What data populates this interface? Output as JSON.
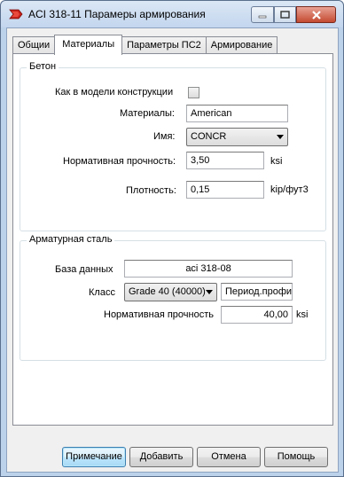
{
  "window": {
    "title": "ACI 318-11 Парамеры армирования"
  },
  "tabs": [
    "Общии",
    "Материалы",
    "Параметры ПС2",
    "Армирование"
  ],
  "concrete": {
    "legend": "Бетон",
    "same_as_model_label": "Как в модели конструкции",
    "same_as_model_checked": false,
    "materials_label": "Материалы:",
    "materials_value": "American",
    "name_label": "Имя:",
    "name_value": "CONCR",
    "strength_label": "Нормативная прочность:",
    "strength_value": "3,50",
    "strength_unit": "ksi",
    "density_label": "Плотность:",
    "density_value": "0,15",
    "density_unit": "kip/фут3"
  },
  "rebar": {
    "legend": "Арматурная сталь",
    "database_label": "База данных",
    "database_value": "aci 318-08",
    "class_label": "Класс",
    "class_value": "Grade 40 (40000)",
    "profile_value": "Период.профиль",
    "strength_label": "Нормативная прочность",
    "strength_value": "40,00",
    "strength_unit": "ksi"
  },
  "buttons": {
    "note": "Примечание",
    "add": "Добавить",
    "cancel": "Отмена",
    "help": "Помощь"
  }
}
